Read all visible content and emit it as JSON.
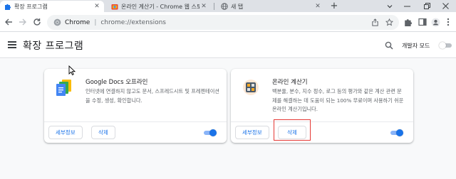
{
  "tabs": [
    {
      "label": "확장 프로그램",
      "icon": "puzzle-icon",
      "active": true
    },
    {
      "label": "온라인 계산기 - Chrome 웹 스토어",
      "icon": "chrome-webstore-icon",
      "active": false
    },
    {
      "label": "새 탭",
      "icon": "globe-icon",
      "active": false
    }
  ],
  "toolbar": {
    "omnibox_site": "Chrome",
    "omnibox_separator": "|",
    "omnibox_url": "chrome://extensions"
  },
  "header": {
    "title": "확장 프로그램",
    "dev_mode_label": "개발자 모드",
    "dev_mode_on": false
  },
  "extensions": [
    {
      "name": "Google Docs 오프라인",
      "description": "인터넷에 연결하지 않고도 문서, 스프레드시트 및 프레젠테이션을 수정, 생성, 확인합니다.",
      "details_label": "세부정보",
      "remove_label": "삭제",
      "enabled": true,
      "icon": "google-docs-offline-icon"
    },
    {
      "name": "온라인 계산기",
      "description": "백분율, 분수, 지수 정수, 로그 등의 평가와 같은 계산 관련 문제를 해결하는 데 도움이 되는 100% 무료이며 사용하기 쉬운 온라인 계산기입니다.",
      "details_label": "세부정보",
      "remove_label": "삭제",
      "enabled": true,
      "icon": "calculator-icon"
    }
  ],
  "colors": {
    "accent": "#1a73e8",
    "highlight": "#e53935",
    "page_bg": "#f8f9fa",
    "tabstrip_bg": "#dee1e6"
  }
}
